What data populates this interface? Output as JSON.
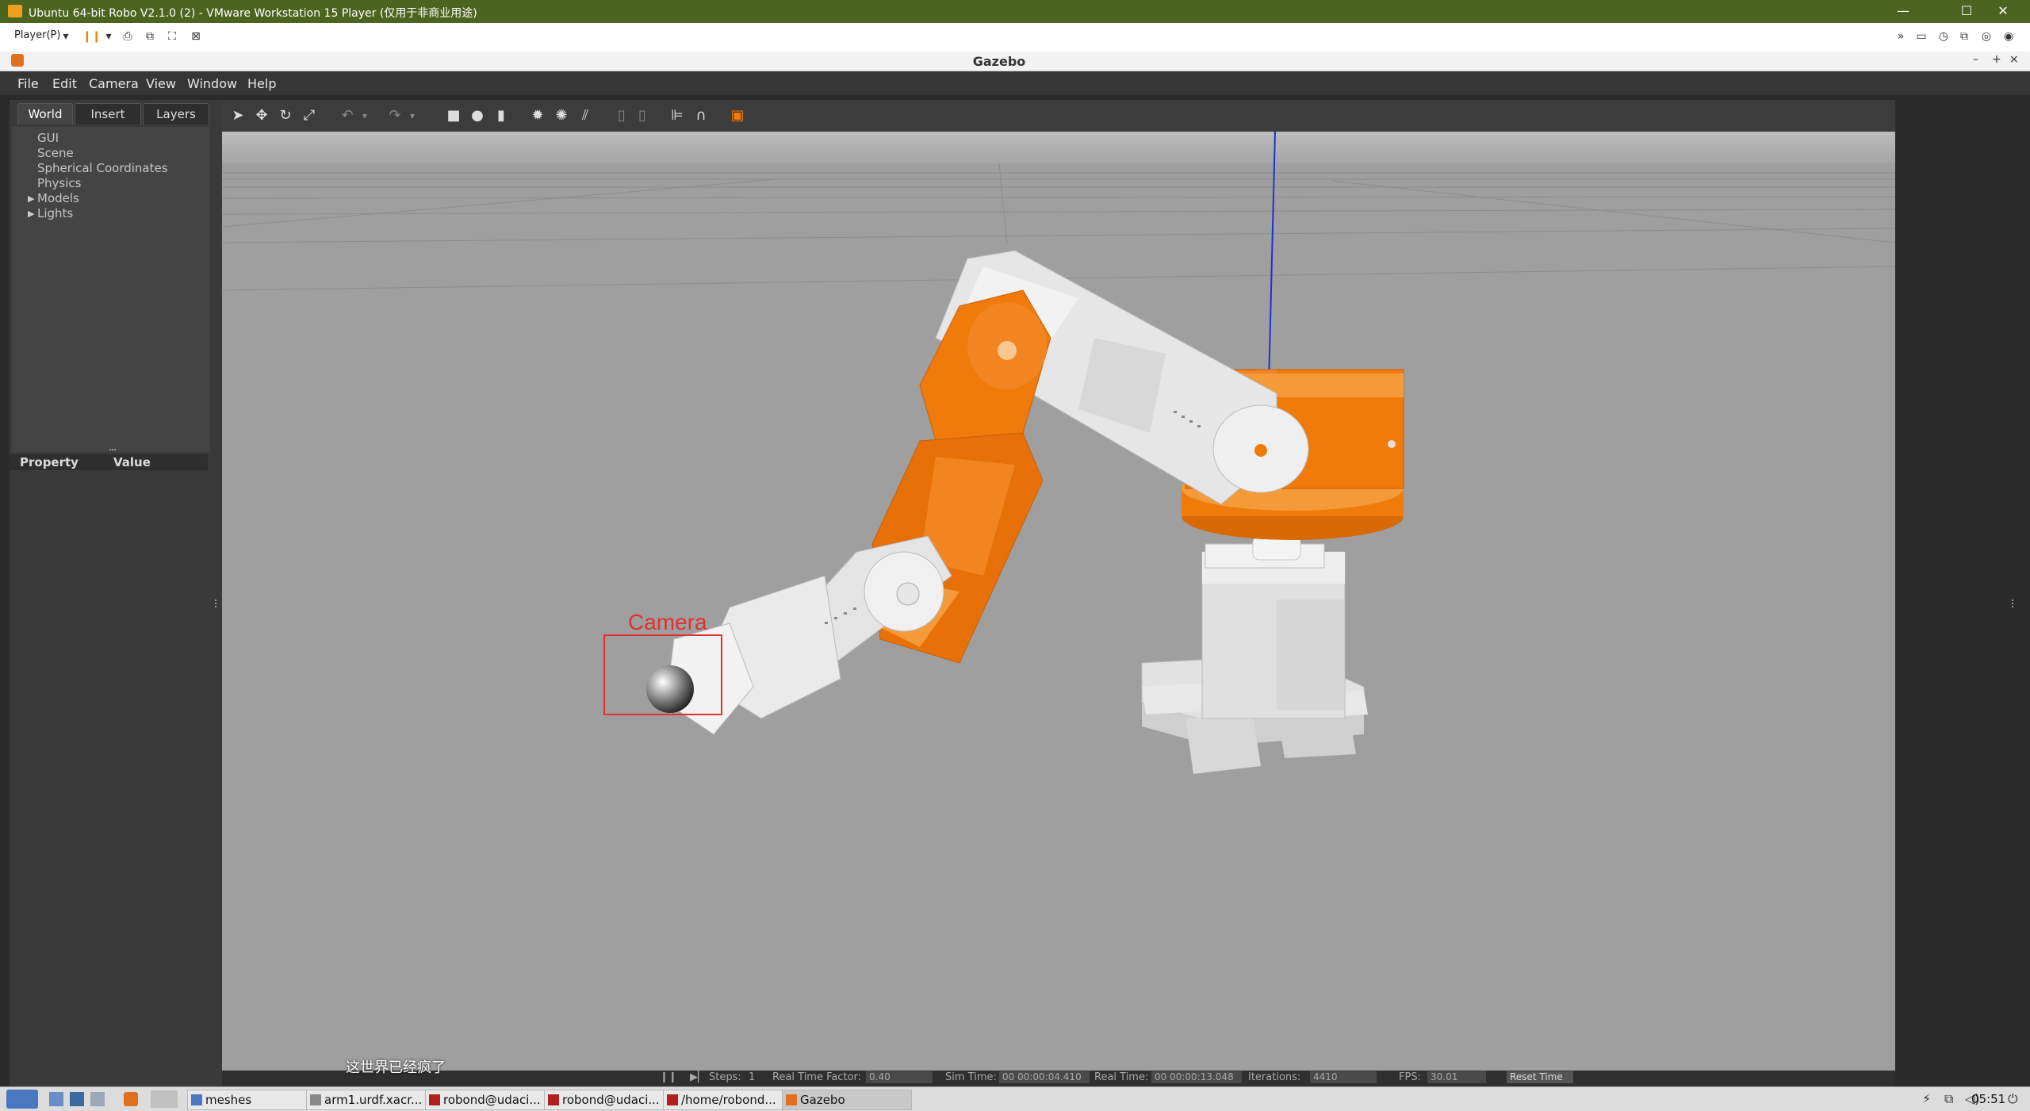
{
  "vm": {
    "title": "Ubuntu 64-bit Robo V2.1.0 (2) - VMware Workstation 15 Player (仅用于非商业用途)",
    "player_menu": "Player(P)",
    "window_controls": {
      "minimize": "—",
      "maximize": "☐",
      "close": "✕"
    }
  },
  "gazebo": {
    "title": "Gazebo",
    "menu": [
      "File",
      "Edit",
      "Camera",
      "View",
      "Window",
      "Help"
    ],
    "tabs": [
      "World",
      "Insert",
      "Layers"
    ],
    "world_tree": [
      "GUI",
      "Scene",
      "Spherical Coordinates",
      "Physics",
      "Models",
      "Lights"
    ],
    "property_header": {
      "property": "Property",
      "value": "Value"
    },
    "annotation_label": "Camera",
    "status": {
      "steps_label": "Steps:",
      "steps_value": "1",
      "rtf_label": "Real Time Factor:",
      "rtf_value": "0.40",
      "sim_time_label": "Sim Time:",
      "sim_time_value": "00 00:00:04.410",
      "real_time_label": "Real Time:",
      "real_time_value": "00 00:00:13.048",
      "iterations_label": "Iterations:",
      "iterations_value": "4410",
      "fps_label": "FPS:",
      "fps_value": "30.01",
      "reset_button": "Reset Time"
    }
  },
  "subtitle": "这世界已经疯了",
  "taskbar": {
    "items": [
      "meshes",
      "arm1.urdf.xacr...",
      "robond@udaci...",
      "robond@udaci...",
      "/home/robond...",
      "Gazebo"
    ],
    "clock": "05:51"
  },
  "colors": {
    "vm_title_bg": "#4b6420",
    "viewport_bg": "#9f9f9f",
    "robot_orange": "#f07a0a",
    "robot_white": "#e6e6e6",
    "annotation_red": "#e03030"
  }
}
